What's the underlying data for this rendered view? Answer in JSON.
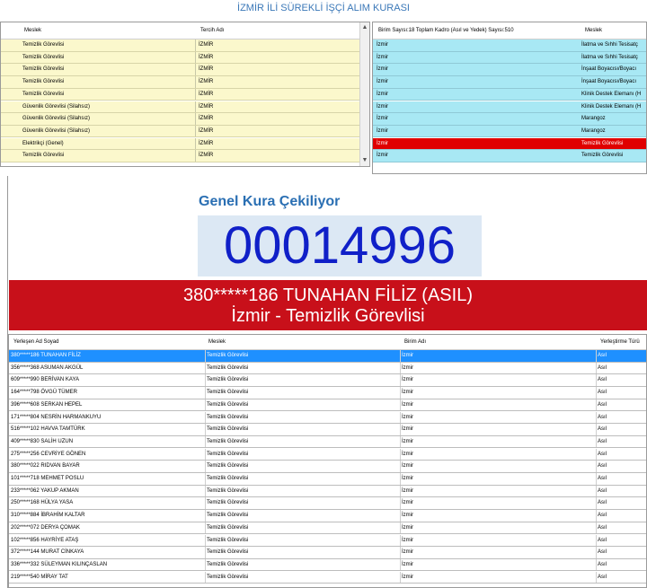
{
  "window": {
    "title": "İZMİR İLİ SÜREKLİ İŞÇİ ALIM KURASI"
  },
  "top_left_grid": {
    "columns": [
      "Meslek",
      "Tercih Adı"
    ],
    "rows": [
      {
        "meslek": "Temizlik Görevlisi",
        "tercih": "İZMİR"
      },
      {
        "meslek": "Temizlik Görevlisi",
        "tercih": "İZMİR"
      },
      {
        "meslek": "Temizlik Görevlisi",
        "tercih": "İZMİR"
      },
      {
        "meslek": "Temizlik Görevlisi",
        "tercih": "İZMİR"
      },
      {
        "meslek": "Temizlik Görevlisi",
        "tercih": "İZMİR"
      },
      {
        "meslek": "Güvenlik Görevlisi (Silahsız)",
        "tercih": "İZMİR"
      },
      {
        "meslek": "Güvenlik Görevlisi (Silahsız)",
        "tercih": "İZMİR"
      },
      {
        "meslek": "Güvenlik Görevlisi (Silahsız)",
        "tercih": "İZMİR"
      },
      {
        "meslek": "Elektrikçi (Genel)",
        "tercih": "İZMİR"
      },
      {
        "meslek": "Temizlik Görevlisi",
        "tercih": "İZMİR"
      }
    ]
  },
  "top_right_grid": {
    "columns": [
      "Birim Sayısı:18 Toplam Kadro (Asıl ve Yedek) Sayısı:510",
      "Meslek"
    ],
    "rows": [
      {
        "birim": "İzmir",
        "meslek": "İlatma ve Sıhhi Tesisatç"
      },
      {
        "birim": "İzmir",
        "meslek": "İlatma ve Sıhhi Tesisatç"
      },
      {
        "birim": "İzmir",
        "meslek": "İnşaat Boyacısı/Boyacı"
      },
      {
        "birim": "İzmir",
        "meslek": "İnşaat Boyacısı/Boyacı"
      },
      {
        "birim": "İzmir",
        "meslek": "Klinik Destek Elemanı (H"
      },
      {
        "birim": "İzmir",
        "meslek": "Klinik Destek Elemanı (H"
      },
      {
        "birim": "İzmir",
        "meslek": "Marangoz"
      },
      {
        "birim": "İzmir",
        "meslek": "Marangoz"
      },
      {
        "birim": "İzmir",
        "meslek": "Temizlik Görevlisi",
        "selected": true
      },
      {
        "birim": "İzmir",
        "meslek": "Temizlik Görevlisi"
      }
    ]
  },
  "announcement": {
    "caption": "Genel Kura Çekiliyor",
    "counter": "00014996",
    "winner_name": "380*****186 TUNAHAN FİLİZ (ASIL)",
    "winner_place": "İzmir - Temizlik Görevlisi"
  },
  "bottom_grid": {
    "columns": [
      "Yerleşen Ad Soyad",
      "Meslek",
      "Birim Adı",
      "Yerleştirme Türü"
    ],
    "rows": [
      {
        "name": "380*****186 TUNAHAN FİLİZ",
        "meslek": "Temizlik Görevlisi",
        "birim": "İzmir",
        "tur": "Asıl",
        "selected": true
      },
      {
        "name": "356*****368 ASUMAN AKGÜL",
        "meslek": "Temizlik Görevlisi",
        "birim": "İzmir",
        "tur": "Asıl"
      },
      {
        "name": "609*****990 BERİVAN KAYA",
        "meslek": "Temizlik Görevlisi",
        "birim": "İzmir",
        "tur": "Asıl"
      },
      {
        "name": "164*****798 ÖVGÜ TÜMER",
        "meslek": "Temizlik Görevlisi",
        "birim": "İzmir",
        "tur": "Asıl"
      },
      {
        "name": "396*****608 SERKAN HEPEL",
        "meslek": "Temizlik Görevlisi",
        "birim": "İzmir",
        "tur": "Asıl"
      },
      {
        "name": "171*****804 NESRİN HARMANKUYU",
        "meslek": "Temizlik Görevlisi",
        "birim": "İzmir",
        "tur": "Asıl"
      },
      {
        "name": "516*****102 HAVVA TAMTÜRK",
        "meslek": "Temizlik Görevlisi",
        "birim": "İzmir",
        "tur": "Asıl"
      },
      {
        "name": "409*****830 SALİH UZUN",
        "meslek": "Temizlik Görevlisi",
        "birim": "İzmir",
        "tur": "Asıl"
      },
      {
        "name": "275*****256 CEVRİYE GÖNEN",
        "meslek": "Temizlik Görevlisi",
        "birim": "İzmir",
        "tur": "Asıl"
      },
      {
        "name": "380*****022 RIDVAN BAYAR",
        "meslek": "Temizlik Görevlisi",
        "birim": "İzmir",
        "tur": "Asıl"
      },
      {
        "name": "101*****718 MEHMET POSLU",
        "meslek": "Temizlik Görevlisi",
        "birim": "İzmir",
        "tur": "Asıl"
      },
      {
        "name": "233*****062 YAKUP AKMAN",
        "meslek": "Temizlik Görevlisi",
        "birim": "İzmir",
        "tur": "Asıl"
      },
      {
        "name": "250*****168 HÜLYA YASA",
        "meslek": "Temizlik Görevlisi",
        "birim": "İzmir",
        "tur": "Asıl"
      },
      {
        "name": "310*****884 İBRAHİM KALTAR",
        "meslek": "Temizlik Görevlisi",
        "birim": "İzmir",
        "tur": "Asıl"
      },
      {
        "name": "202*****072 DERYA ÇOMAK",
        "meslek": "Temizlik Görevlisi",
        "birim": "İzmir",
        "tur": "Asıl"
      },
      {
        "name": "102*****856 HAYRİYE ATAŞ",
        "meslek": "Temizlik Görevlisi",
        "birim": "İzmir",
        "tur": "Asıl"
      },
      {
        "name": "372*****144 MURAT CİNKAYA",
        "meslek": "Temizlik Görevlisi",
        "birim": "İzmir",
        "tur": "Asıl"
      },
      {
        "name": "336*****332 SÜLEYMAN KILINÇASLAN",
        "meslek": "Temizlik Görevlisi",
        "birim": "İzmir",
        "tur": "Asıl"
      },
      {
        "name": "219*****540 MİRAY TAT",
        "meslek": "Temizlik Görevlisi",
        "birim": "İzmir",
        "tur": "Asıl"
      }
    ]
  }
}
